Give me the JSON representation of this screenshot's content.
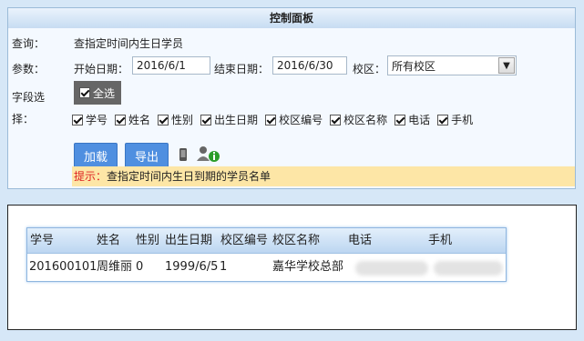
{
  "panel": {
    "title": "控制面板",
    "query_label": "查询：",
    "query_value": "查指定时间内生日学员",
    "params_label": "参数：",
    "start_label": "开始日期：",
    "start_value": "2016/6/1",
    "end_label": "结束日期：",
    "end_value": "2016/6/30",
    "campus_label": "校区：",
    "campus_value": "所有校区",
    "fields_label_line1": "字段选",
    "fields_label_line2": "择：",
    "select_all": "全选",
    "fields": [
      "学号",
      "姓名",
      "性别",
      "出生日期",
      "校区编号",
      "校区名称",
      "电话",
      "手机"
    ],
    "load_button": "加载",
    "export_button": "导出",
    "tip_label": "提示：",
    "tip_text": "查指定时间内生日到期的学员名单"
  },
  "grid": {
    "headers": [
      "学号",
      "姓名",
      "性别",
      "出生日期",
      "校区编号",
      "校区名称",
      "电话",
      "手机"
    ],
    "rows": [
      [
        "201600101",
        "周维丽",
        "0",
        "1999/6/5",
        "1",
        "嘉华学校总部"
      ]
    ]
  }
}
